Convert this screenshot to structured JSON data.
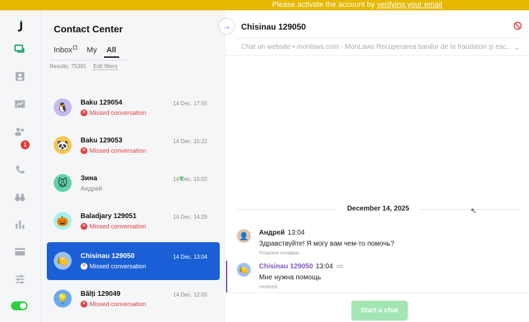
{
  "banner": {
    "text": "Please activate the account by ",
    "link": "verifying your email"
  },
  "sidebar": {
    "badge_count": "1",
    "accent": "#1a5fd6",
    "toggle_color": "#2ecc40"
  },
  "list": {
    "title": "Contact Center",
    "tabs": [
      "Inbox",
      "My",
      "All"
    ],
    "active_tab": "All",
    "results": "Results: 75391",
    "edit_filters": "Edit filters",
    "conversations": [
      {
        "name": "Baku 129054",
        "time": "14 Dec. 17:55",
        "status": "Missed conversation",
        "avatar_icon": "penguin-icon"
      },
      {
        "name": "Baku 129053",
        "time": "14 Dec. 15:22",
        "status": "Missed conversation",
        "avatar_icon": "panda-icon"
      },
      {
        "name": "Зина",
        "time": "14 Dec. 15:02",
        "status": "Андрей",
        "avatar_icon": "mouse-icon"
      },
      {
        "name": "Baladjary 129051",
        "time": "14 Dec. 14:29",
        "status": "Missed conversation",
        "avatar_icon": "pumpkin-icon"
      },
      {
        "name": "Chisinau 129050",
        "time": "14 Dec. 13:04",
        "status": "Missed conversation",
        "avatar_icon": "lemon-icon"
      },
      {
        "name": "Bălți 129049",
        "time": "14 Dec. 12:05",
        "status": "Missed conversation",
        "avatar_icon": "bulb-icon"
      }
    ]
  },
  "chat": {
    "title": "Chisinau 129050",
    "source": "Chat on website • monlaws.com - MonLaws Recuperarea banilor de la fraudatori și esc...",
    "date": "December 14, 2025",
    "messages": [
      {
        "author": "Андрей",
        "time": "13:04",
        "text": "Здравствуйте! Я могу вам чем-то помочь?",
        "note": "Proactive invitation",
        "author_color": "#222222"
      },
      {
        "author": "Chisinau 129050",
        "time": "13:04",
        "text": "Мне нужна помощь",
        "note": "received",
        "author_color": "#7e57c2"
      }
    ],
    "start_button": "Start a chat",
    "start_color": "#a3e6b3"
  }
}
